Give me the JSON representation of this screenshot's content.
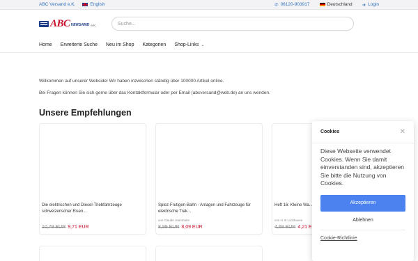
{
  "topbar": {
    "shop_name": "ABC Versand e.K.",
    "language_link": "English",
    "phone": "06120-903917",
    "country": "Deutschland",
    "login": "Login"
  },
  "logo": {
    "abc": "ABC",
    "versand": "VERSAND",
    "ek": "e.K."
  },
  "search": {
    "placeholder": "Suche..."
  },
  "nav": {
    "items": [
      "Home",
      "Erweiterte Suche",
      "Neu im Shop",
      "Kategorien",
      "Shop-Links"
    ]
  },
  "content": {
    "welcome": "Willkommen auf unserer Webside! Wir haben inzwischen ständig über 100000 Artikel online.",
    "contact": "Bei Fragen können Sie sich gerne über das Kontaktformular oder per Email (abcversand@web.de) an uns wenden.",
    "section_title": "Unsere Empfehlungen"
  },
  "products": [
    {
      "title": "Die elektrischen und Diesel-Triebfahrzeuge schweizerischer Eisen...",
      "author": "",
      "old_price": "10,79 EUR",
      "new_price": "9,71 EUR"
    },
    {
      "title": "Spiez-Frutigen-Bahn - Anlagen und Fahrzeuge für elektrische Trak...",
      "author": "von Claude Jeanmaire",
      "old_price": "8,99 EUR",
      "new_price": "8,09 EUR"
    },
    {
      "title": "Heft 16: Kleine Wa... Forscher und Li...",
      "author": "von H. B Lockhoven",
      "old_price": "4,68 EUR",
      "new_price": "4,21 EUR"
    }
  ],
  "cookie": {
    "title": "Cookies",
    "text": "Diese Webseite verwendet Cookies. Wenn Sie damit einverstanden sind, akzeptieren Sie bitte die Nutzung von Cookies.",
    "accept": "Akzeptieren",
    "decline": "Ablehnen",
    "policy": "Cookie-Richtlinie"
  },
  "colors": {
    "accent_blue": "#2d6fb8",
    "price_red": "#c8102e",
    "accept_button": "#4b82f0"
  }
}
